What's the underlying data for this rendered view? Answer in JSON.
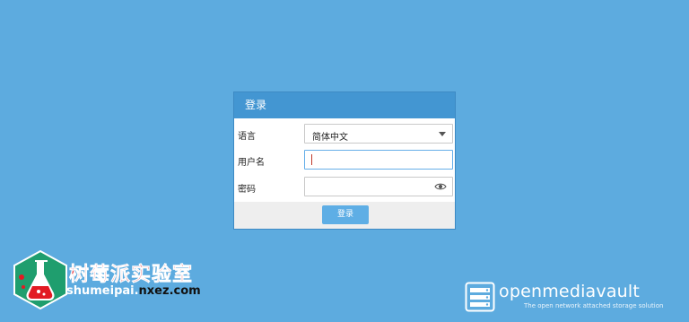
{
  "login": {
    "title": "登录",
    "language_label": "语言",
    "language_value": "简体中文",
    "username_label": "用户名",
    "username_value": "",
    "password_label": "密码",
    "password_value": "",
    "submit_label": "登录"
  },
  "branding_left": {
    "name": "树莓派实验室",
    "url_prefix": "shumeipai.",
    "url_domain": "nxez.com"
  },
  "branding_right": {
    "name": "openmediavault",
    "tagline": "The open network attached storage solution"
  },
  "colors": {
    "background": "#5dabdf",
    "header": "#4396d2",
    "button": "#5eaee5",
    "brand_red": "#e21b23",
    "hex_green": "#1f9e6e"
  },
  "icons": {
    "dropdown": "caret-down-icon",
    "password_toggle": "eye-icon",
    "brand_logo": "flask-hexagon-icon",
    "omv_logo": "server-rack-icon"
  }
}
